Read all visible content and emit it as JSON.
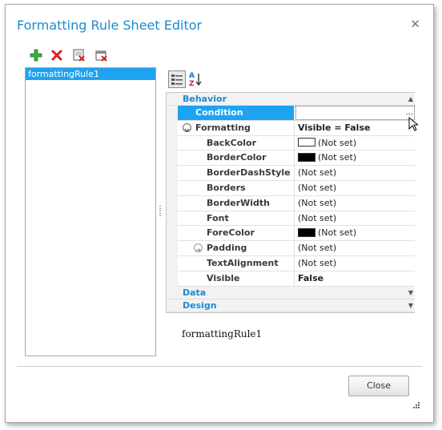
{
  "window": {
    "title": "Formatting Rule Sheet Editor"
  },
  "toolbar": {
    "buttons": [
      {
        "name": "add-icon",
        "color": "#2fa83a"
      },
      {
        "name": "delete-icon",
        "color": "#d62020"
      },
      {
        "name": "delete-rule-icon",
        "color": "#d62020"
      },
      {
        "name": "purge-rules-icon",
        "color": "#d62020"
      }
    ]
  },
  "rules_list": {
    "items": [
      "formattingRule1"
    ],
    "selected": 0
  },
  "property_grid": {
    "categories": [
      {
        "name": "Behavior",
        "expanded": true
      },
      {
        "name": "Data",
        "expanded": false
      },
      {
        "name": "Design",
        "expanded": false
      }
    ],
    "rows": [
      {
        "name": "Condition",
        "value": "",
        "selected": true
      },
      {
        "name": "Formatting",
        "value": "Visible = False",
        "bold_value": true,
        "expander": "collapse"
      },
      {
        "name": "BackColor",
        "value": "(Not set)",
        "swatch": "#ffffff"
      },
      {
        "name": "BorderColor",
        "value": "(Not set)",
        "swatch": "#000000"
      },
      {
        "name": "BorderDashStyle",
        "value": "(Not set)"
      },
      {
        "name": "Borders",
        "value": "(Not set)"
      },
      {
        "name": "BorderWidth",
        "value": "(Not set)"
      },
      {
        "name": "Font",
        "value": "(Not set)"
      },
      {
        "name": "ForeColor",
        "value": "(Not set)",
        "swatch": "#000000"
      },
      {
        "name": "Padding",
        "value": "(Not set)",
        "expander": "expand"
      },
      {
        "name": "TextAlignment",
        "value": "(Not set)"
      },
      {
        "name": "Visible",
        "value": "False",
        "bold_value": true
      }
    ],
    "condition_button": "..."
  },
  "description": "formattingRule1",
  "footer": {
    "close_label": "Close"
  },
  "colors": {
    "accent": "#1da3f2",
    "title": "#1e8ad0"
  }
}
